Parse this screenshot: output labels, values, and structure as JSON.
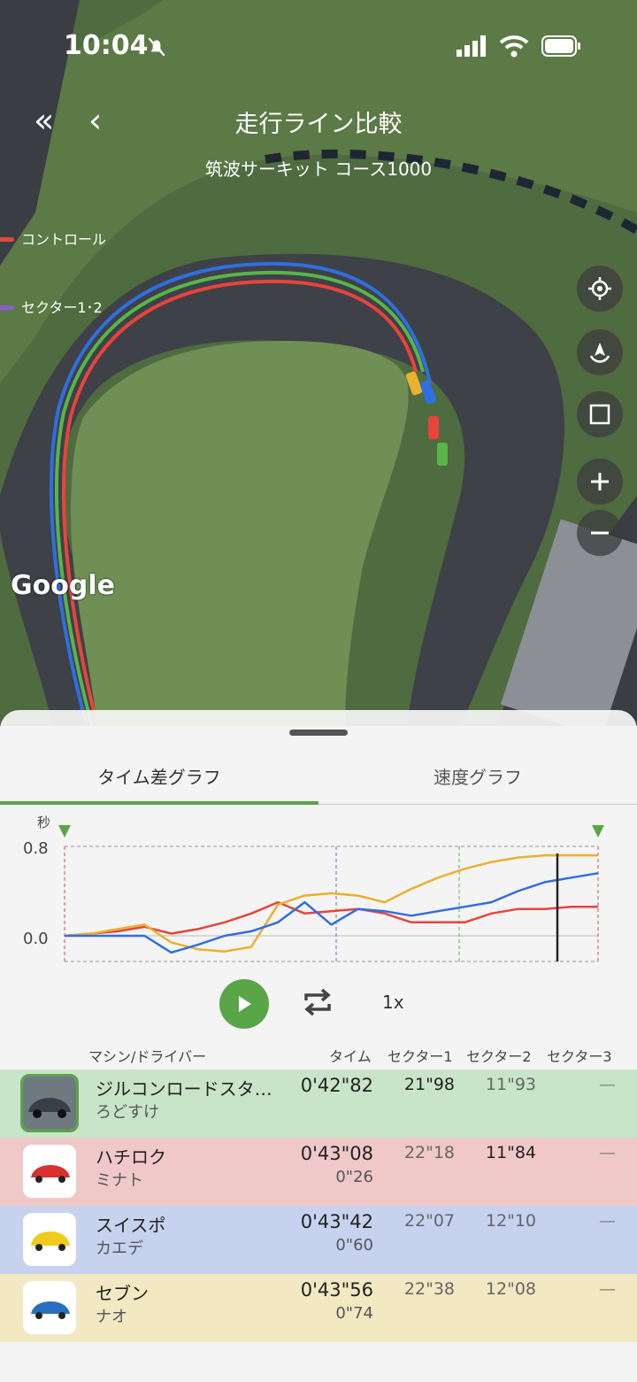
{
  "status_bar": {
    "time": "10:04"
  },
  "header": {
    "title": "走行ライン比較",
    "subtitle": "筑波サーキット コース1000",
    "back_double": "«",
    "back": "‹"
  },
  "map": {
    "legend": [
      {
        "label": "コントロール",
        "color": "#e04b40"
      },
      {
        "label": "セクター1･2",
        "color": "#8a5bd1"
      }
    ],
    "google_logo": "Google",
    "lines": [
      {
        "name": "red",
        "color": "#e8443b"
      },
      {
        "name": "green",
        "color": "#58b548"
      },
      {
        "name": "blue",
        "color": "#2f6fe0"
      },
      {
        "name": "yellow",
        "color": "#e9b12e"
      }
    ]
  },
  "tabs": [
    {
      "label": "タイム差グラフ",
      "active": true
    },
    {
      "label": "速度グラフ",
      "active": false
    }
  ],
  "graph": {
    "y_unit": "秒",
    "y_ticks": [
      "0.8",
      "0.0"
    ],
    "chart_data": {
      "type": "line",
      "ylabel": "秒",
      "ylim": [
        -0.2,
        0.8
      ],
      "x": [
        0,
        0.05,
        0.1,
        0.15,
        0.2,
        0.25,
        0.3,
        0.35,
        0.4,
        0.45,
        0.5,
        0.55,
        0.6,
        0.65,
        0.7,
        0.75,
        0.8,
        0.85,
        0.9,
        0.95,
        1.0
      ],
      "series": [
        {
          "name": "",
          "color": "#e8443b",
          "values": [
            0,
            0.02,
            0.04,
            0.08,
            0.02,
            0.06,
            0.12,
            0.2,
            0.3,
            0.2,
            0.22,
            0.24,
            0.2,
            0.12,
            0.12,
            0.12,
            0.2,
            0.24,
            0.24,
            0.26,
            0.26
          ]
        },
        {
          "name": "",
          "color": "#e9b12e",
          "values": [
            0,
            0.02,
            0.06,
            0.1,
            -0.06,
            -0.12,
            -0.14,
            -0.1,
            0.28,
            0.36,
            0.38,
            0.36,
            0.3,
            0.42,
            0.52,
            0.6,
            0.66,
            0.7,
            0.72,
            0.72,
            0.72
          ]
        },
        {
          "name": "",
          "color": "#2f6fe0",
          "values": [
            0,
            0.0,
            0.0,
            0.0,
            -0.15,
            -0.08,
            0.0,
            0.04,
            0.12,
            0.3,
            0.1,
            0.24,
            0.22,
            0.18,
            0.22,
            0.26,
            0.3,
            0.4,
            0.48,
            0.52,
            0.56
          ]
        }
      ]
    },
    "play_label": "再生",
    "speed": "1x"
  },
  "table": {
    "headers": {
      "machine": "マシン/ドライバー",
      "time": "タイム",
      "s1": "セクター1",
      "s2": "セクター2",
      "s3": "セクター3"
    },
    "rows": [
      {
        "name": "ジルコンロードスタ…",
        "driver": "ろどすけ",
        "time": "0'42\"82",
        "gap": "",
        "s1": "21\"98",
        "s2": "11\"93",
        "s3": "—",
        "bg": "rgba(120,200,120,0.35)",
        "car_color": "#3a3f44",
        "selected": true
      },
      {
        "name": "ハチロク",
        "driver": "ミナト",
        "time": "0'43\"08",
        "gap": "0\"26",
        "s1": "22\"18",
        "s2": "11\"84",
        "s3": "—",
        "bg": "rgba(235,130,130,0.38)",
        "car_color": "#d93030",
        "selected": false
      },
      {
        "name": "スイスポ",
        "driver": "カエデ",
        "time": "0'43\"42",
        "gap": "0\"60",
        "s1": "22\"07",
        "s2": "12\"10",
        "s3": "—",
        "bg": "rgba(130,160,230,0.40)",
        "car_color": "#f0cc1a",
        "selected": false
      },
      {
        "name": "セブン",
        "driver": "ナオ",
        "time": "0'43\"56",
        "gap": "0\"74",
        "s1": "22\"38",
        "s2": "12\"08",
        "s3": "—",
        "bg": "rgba(240,215,120,0.40)",
        "car_color": "#2a6fbf",
        "selected": false
      }
    ]
  }
}
